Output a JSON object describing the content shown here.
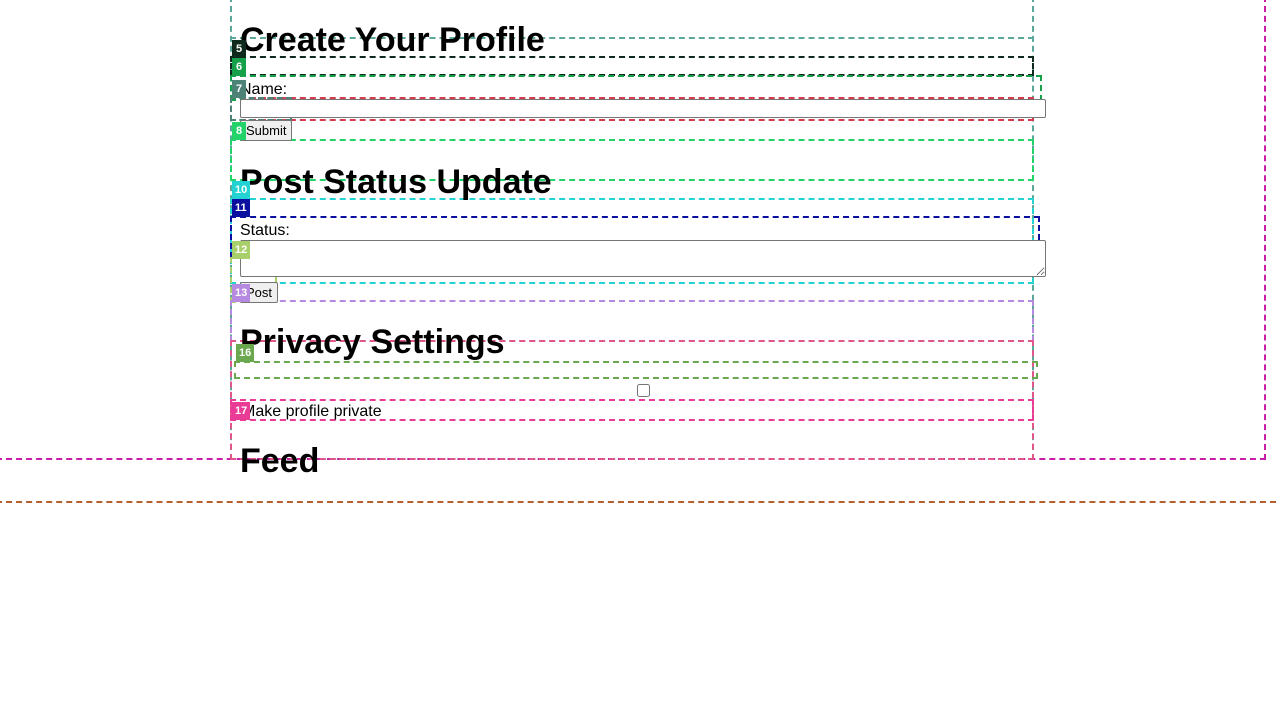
{
  "profile": {
    "heading": "Create Your Profile",
    "name_label": "Name:",
    "name_value": "",
    "submit_label": "Submit"
  },
  "status": {
    "heading": "Post Status Update",
    "status_label": "Status:",
    "status_value": "",
    "post_label": "Post"
  },
  "privacy": {
    "heading": "Privacy Settings",
    "private_label": "Make profile private",
    "private_checked": false
  },
  "feed": {
    "heading": "Feed"
  },
  "overlay": {
    "tags": [
      {
        "id": "5",
        "color": "#0f2a1c"
      },
      {
        "id": "6",
        "color": "#15a14a"
      },
      {
        "id": "7",
        "color": "#4d8277"
      },
      {
        "id": "8",
        "color": "#22d36a"
      },
      {
        "id": "10",
        "color": "#23d3d3"
      },
      {
        "id": "11",
        "color": "#0a0fa0"
      },
      {
        "id": "12",
        "color": "#a8cf6a"
      },
      {
        "id": "13",
        "color": "#b68ae0"
      },
      {
        "id": "16",
        "color": "#6aa84f"
      },
      {
        "id": "17",
        "color": "#ea3c96"
      }
    ],
    "colors": {
      "outer_magenta": "#c81ea8",
      "outer_brown": "#b4602c",
      "container_teal": "#5aa89a",
      "name_red": "#d23c4c",
      "privacy_pink": "#e0558a"
    }
  }
}
